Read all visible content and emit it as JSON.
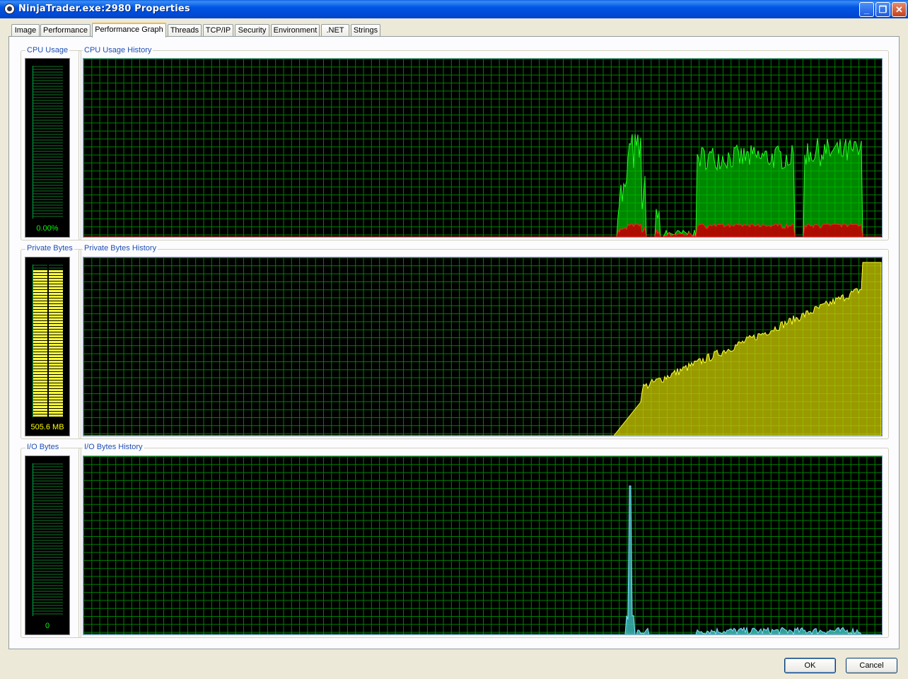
{
  "window": {
    "title": "NinjaTrader.exe:2980 Properties",
    "minimize_glyph": "_",
    "maximize_glyph": "❐",
    "close_glyph": "✕"
  },
  "tabs": [
    "Image",
    "Performance",
    "Performance Graph",
    "Threads",
    "TCP/IP",
    "Security",
    "Environment",
    ".NET",
    "Strings"
  ],
  "active_tab": "Performance Graph",
  "sections": {
    "cpu": {
      "meter_label": "CPU Usage",
      "history_label": "CPU Usage History",
      "meter_value": "0.00%",
      "meter_fill": 0.0
    },
    "private_bytes": {
      "meter_label": "Private Bytes",
      "history_label": "Private Bytes History",
      "meter_value": "505.6 MB",
      "meter_fill": 0.97
    },
    "io": {
      "meter_label": "I/O Bytes",
      "history_label": "I/O Bytes History",
      "meter_value": "0",
      "meter_fill": 0.0
    }
  },
  "buttons": {
    "ok": "OK",
    "cancel": "Cancel"
  },
  "colors": {
    "grid": "#008000",
    "cpu_total": "#00c000",
    "cpu_kernel": "#c00000",
    "private_bytes": "#cccc00",
    "io": "#40c0c0",
    "meter_text_green": "#00ff00",
    "meter_text_yellow": "#ffff00"
  }
}
